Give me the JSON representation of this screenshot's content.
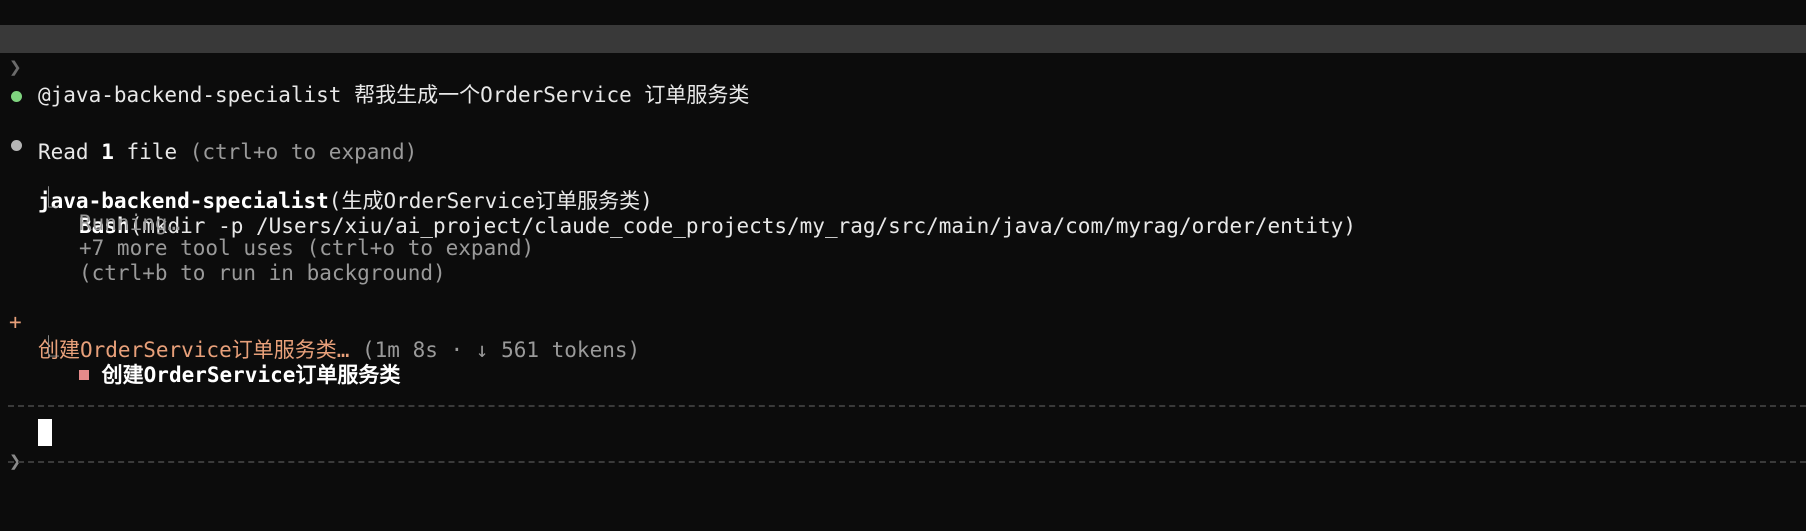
{
  "echo": {
    "chevron": "❯",
    "text": "@java-backend-specialist 帮我生成一个OrderService 订单服务类"
  },
  "read": {
    "bullet_color": "#7fd47f",
    "prefix": "Read ",
    "count": "1",
    "noun": " file ",
    "hint": "(ctrl+o to expand)"
  },
  "agent": {
    "bullet_color": "#b5b5b5",
    "name": "java-backend-specialist",
    "args": "(生成OrderService订单服务类)",
    "tool_branch": "⎿",
    "tool_name": "Bash",
    "tool_args": "(mkdir -p /Users/xiu/ai_project/claude_code_projects/my_rag/src/main/java/com/myrag/order/entity)",
    "status": "Running…",
    "more": "+7 more tool uses (ctrl+o to expand)",
    "bg_hint": "(ctrl+b to run in background)"
  },
  "task": {
    "marker": "+",
    "title": "创建OrderService订单服务类…",
    "meta": " (1m 8s · ↓ 561 tokens)",
    "branch": "⎿",
    "todo_label": "创建OrderService订单服务类",
    "todo_color": "#e58a8a",
    "accent_color": "#e8a07a"
  },
  "input": {
    "chevron": "❯",
    "value": ""
  }
}
